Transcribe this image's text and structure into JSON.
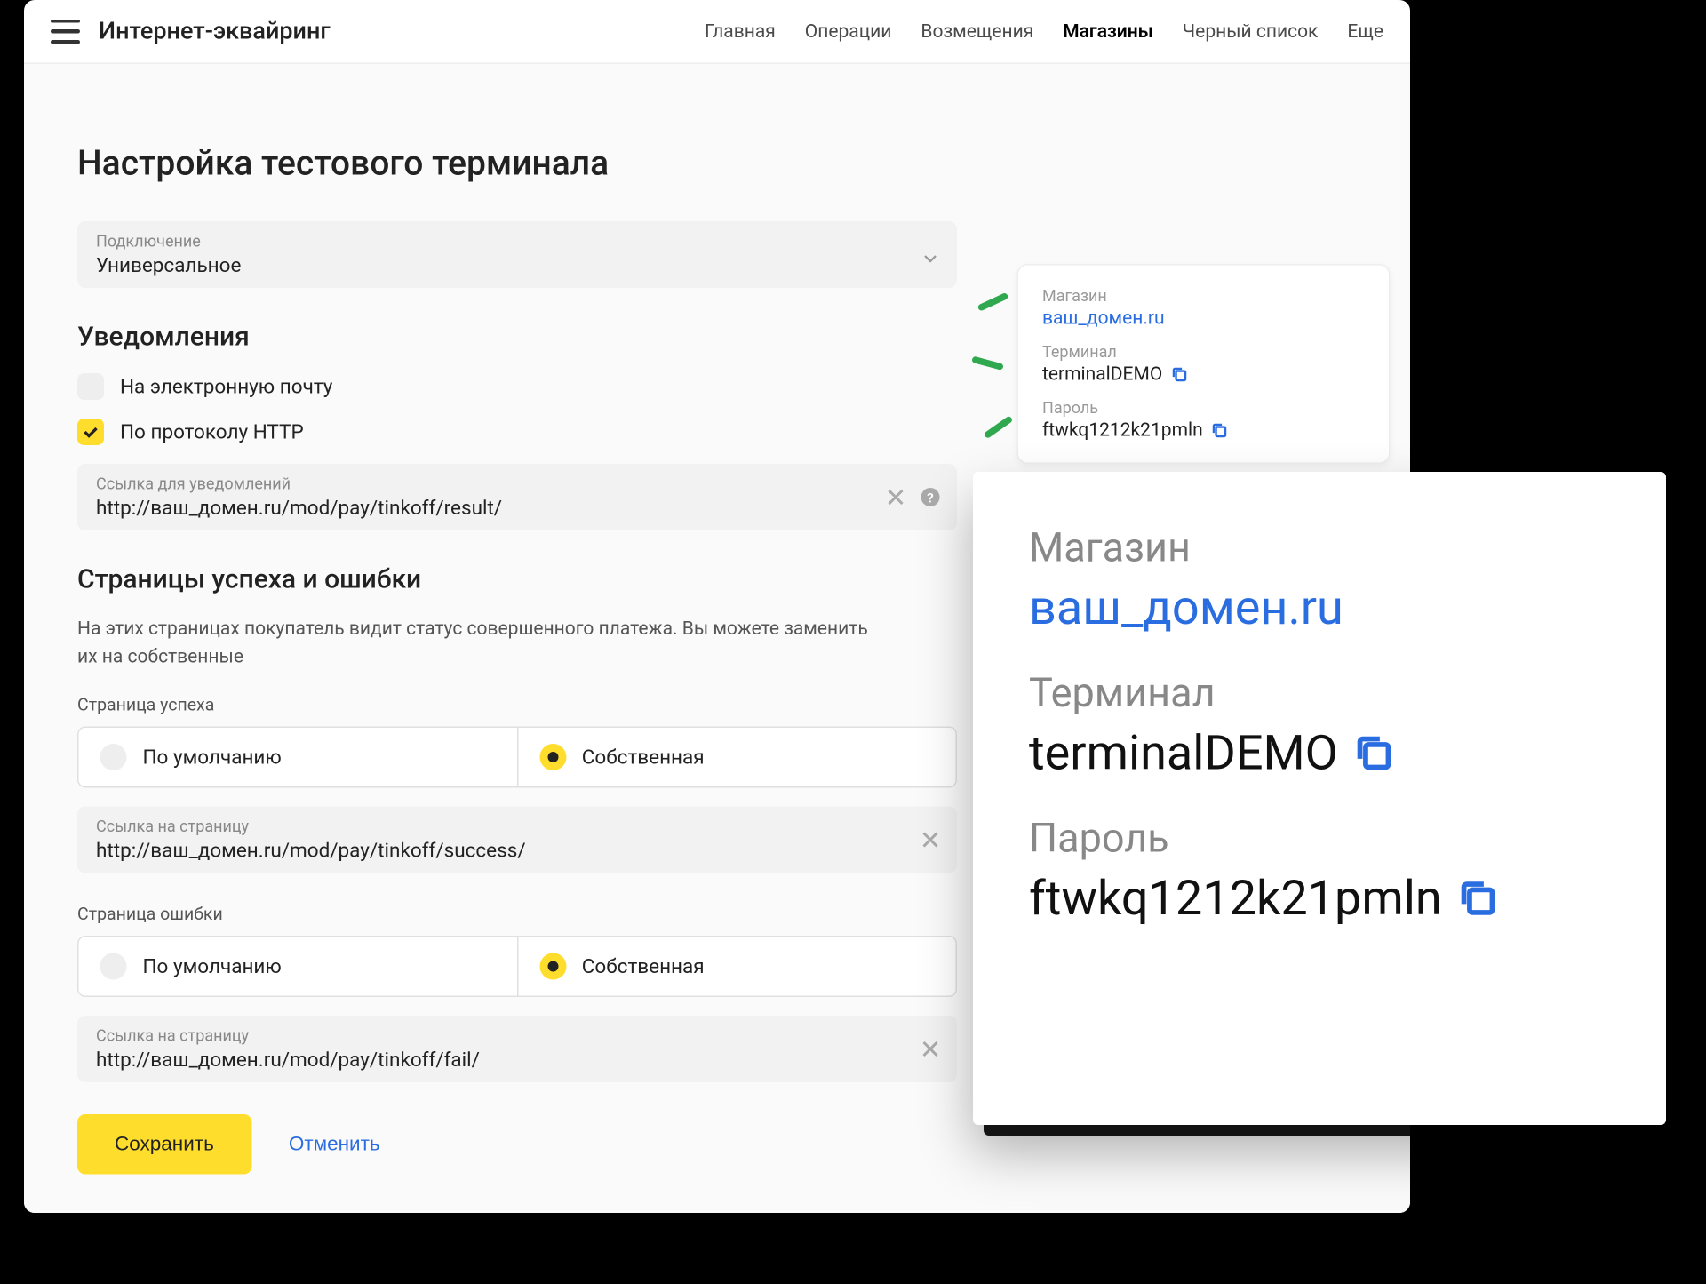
{
  "app_title": "Интернет-эквайринг",
  "nav": {
    "items": [
      {
        "label": "Главная"
      },
      {
        "label": "Операции"
      },
      {
        "label": "Возмещения"
      },
      {
        "label": "Магазины",
        "active": true
      },
      {
        "label": "Черный список"
      },
      {
        "label": "Еще"
      }
    ]
  },
  "page": {
    "title": "Настройка тестового терминала",
    "connection": {
      "label": "Подключение",
      "value": "Универсальное"
    },
    "notifications": {
      "title": "Уведомления",
      "email": {
        "label": "На электронную почту",
        "checked": false
      },
      "http": {
        "label": "По протоколу HTTP",
        "checked": true
      },
      "url": {
        "label": "Ссылка для уведомлений",
        "value": "http://ваш_домен.ru/mod/pay/tinkoff/result/"
      }
    },
    "pages_section": {
      "title": "Страницы успеха и ошибки",
      "desc": "На этих страницах покупатель видит статус совершенного платежа. Вы можете заменить их на собственные",
      "success": {
        "label": "Страница успеха",
        "opt_default": "По умолчанию",
        "opt_custom": "Собственная",
        "url_label": "Ссылка на страницу",
        "url_value": "http://ваш_домен.ru/mod/pay/tinkoff/success/"
      },
      "error": {
        "label": "Страница ошибки",
        "opt_default": "По умолчанию",
        "opt_custom": "Собственная",
        "url_label": "Ссылка на страницу",
        "url_value": "http://ваш_домен.ru/mod/pay/tinkoff/fail/"
      }
    },
    "buttons": {
      "save": "Сохранить",
      "cancel": "Отменить"
    }
  },
  "side_card": {
    "shop_label": "Магазин",
    "shop_value": "ваш_домен.ru",
    "terminal_label": "Терминал",
    "terminal_value": "terminalDEMO",
    "password_label": "Пароль",
    "password_value": "ftwkq1212k21pmln"
  },
  "zoom": {
    "shop_label": "Магазин",
    "shop_value": "ваш_домен.ru",
    "terminal_label": "Терминал",
    "terminal_value": "terminalDEMO",
    "password_label": "Пароль",
    "password_value": "ftwkq1212k21pmln"
  }
}
